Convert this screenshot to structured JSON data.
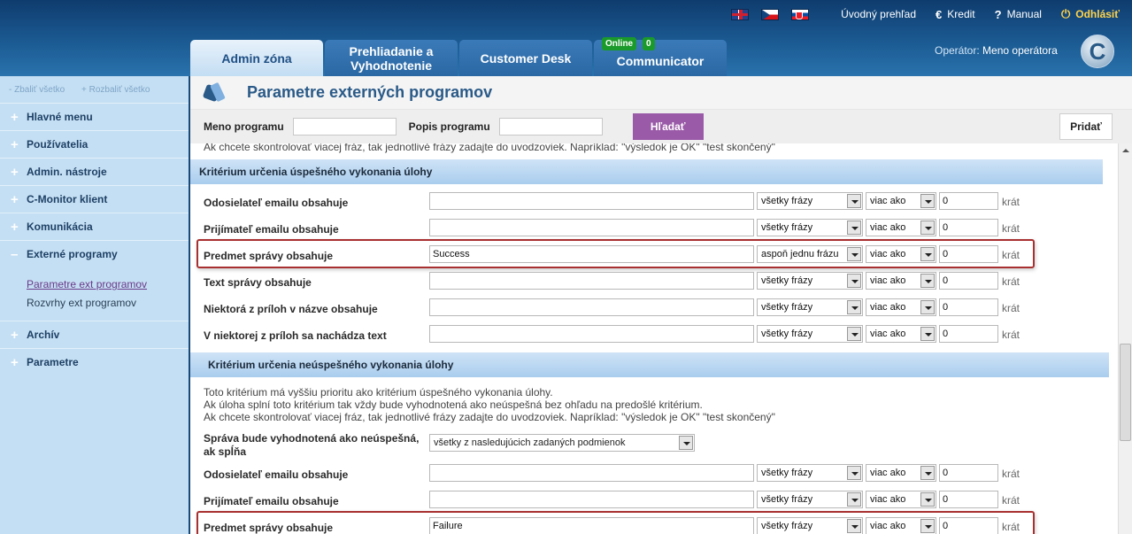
{
  "header": {
    "links": {
      "home": "Úvodný prehľad",
      "credit": "Kredit",
      "manual": "Manual",
      "logout": "Odhlásiť"
    },
    "icons": {
      "credit": "€",
      "manual": "?",
      "logout": "⏻"
    },
    "operator_label": "Operátor:",
    "operator_name": "Meno operátora",
    "logo_letter": "C"
  },
  "tabs": [
    {
      "label": "Admin zóna"
    },
    {
      "label": "Prehliadanie a Vyhodnotenie"
    },
    {
      "label": "Customer Desk"
    },
    {
      "label": "Communicator"
    }
  ],
  "badges": {
    "online": "Online",
    "count": "0"
  },
  "sidebar": {
    "collapse_all": "- Zbaliť všetko",
    "expand_all": "+ Rozbaliť všetko",
    "items": [
      {
        "sign": "+",
        "label": "Hlavné menu"
      },
      {
        "sign": "+",
        "label": "Používatelia"
      },
      {
        "sign": "+",
        "label": "Admin. nástroje"
      },
      {
        "sign": "+",
        "label": "C-Monitor klient"
      },
      {
        "sign": "+",
        "label": "Komunikácia"
      },
      {
        "sign": "–",
        "label": "Externé programy"
      }
    ],
    "subitems": [
      "Parametre ext programov",
      "Rozvrhy ext programov"
    ],
    "items_after": [
      {
        "sign": "+",
        "label": "Archív"
      },
      {
        "sign": "+",
        "label": "Parametre"
      }
    ]
  },
  "page": {
    "title": "Parametre externých programov",
    "search": {
      "name_label": "Meno programu",
      "desc_label": "Popis programu",
      "search_button": "Hľadať",
      "add_button": "Pridať"
    },
    "cut_text": "Ak chcete skontrolovať viacej fráz, tak jednotlivé frázy zadajte do uvodzoviek. Napríklad: \"výsledok je OK\" \"test skončený\"",
    "section_success": "Kritérium určenia úspešného vykonania úlohy",
    "section_failure": "Kritérium určenia neúspešného vykonania úlohy",
    "unit": "krát",
    "success_rows": [
      {
        "label": "Odosielateľ emailu obsahuje",
        "value": "",
        "match": "všetky frázy",
        "cmp": "viac ako",
        "count": "0"
      },
      {
        "label": "Prijímateľ emailu obsahuje",
        "value": "",
        "match": "všetky frázy",
        "cmp": "viac ako",
        "count": "0"
      },
      {
        "label": "Predmet správy obsahuje",
        "value": "Success",
        "match": "aspoň jednu frázu",
        "cmp": "viac ako",
        "count": "0"
      },
      {
        "label": "Text správy obsahuje",
        "value": "",
        "match": "všetky frázy",
        "cmp": "viac ako",
        "count": "0"
      },
      {
        "label": "Niektorá z príloh v názve obsahuje",
        "value": "",
        "match": "všetky frázy",
        "cmp": "viac ako",
        "count": "0"
      },
      {
        "label": "V niektorej z príloh sa nachádza text",
        "value": "",
        "match": "všetky frázy",
        "cmp": "viac ako",
        "count": "0"
      }
    ],
    "failure_info": [
      "Toto kritérium má vyššiu prioritu ako kritérium úspešného vykonania úlohy.",
      "Ak úloha splní toto kritérium tak vždy bude vyhodnotená ako neúspešná bez ohľadu na predošlé kritérium.",
      "Ak chcete skontrolovať viacej fráz, tak jednotlivé frázy zadajte do uvodzoviek. Napríklad: \"výsledok je OK\" \"test skončený\""
    ],
    "condition_label": "Správa bude vyhodnotená ako neúspešná, ak spĺňa",
    "condition_value": "všetky z nasledujúcich zadaných podmienok",
    "failure_rows": [
      {
        "label": "Odosielateľ emailu obsahuje",
        "value": "",
        "match": "všetky frázy",
        "cmp": "viac ako",
        "count": "0"
      },
      {
        "label": "Prijímateľ emailu obsahuje",
        "value": "",
        "match": "všetky frázy",
        "cmp": "viac ako",
        "count": "0"
      },
      {
        "label": "Predmet správy obsahuje",
        "value": "Failure",
        "match": "všetky frázy",
        "cmp": "viac ako",
        "count": "0"
      }
    ]
  }
}
